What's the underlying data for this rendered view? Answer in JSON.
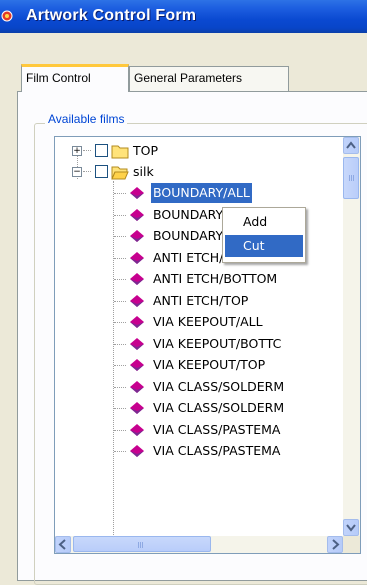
{
  "window": {
    "title": "Artwork Control Form"
  },
  "tabs": [
    {
      "label": "Film Control",
      "active": true
    },
    {
      "label": "General Parameters",
      "active": false
    }
  ],
  "group": {
    "label": "Available films"
  },
  "tree": {
    "folders": [
      {
        "label": "TOP",
        "expanded": false,
        "icon": "folder-closed-icon"
      },
      {
        "label": "silk",
        "expanded": true,
        "icon": "folder-open-icon"
      }
    ],
    "films": [
      {
        "label": "BOUNDARY/ALL",
        "selected": true
      },
      {
        "label": "BOUNDARY/BOTTOM"
      },
      {
        "label": "BOUNDARY/TOP"
      },
      {
        "label": "ANTI ETCH/ALL"
      },
      {
        "label": "ANTI ETCH/BOTTOM"
      },
      {
        "label": "ANTI ETCH/TOP"
      },
      {
        "label": "VIA KEEPOUT/ALL"
      },
      {
        "label": "VIA KEEPOUT/BOTTC"
      },
      {
        "label": "VIA KEEPOUT/TOP"
      },
      {
        "label": "VIA CLASS/SOLDERM"
      },
      {
        "label": "VIA CLASS/SOLDERM"
      },
      {
        "label": "VIA CLASS/PASTEMA"
      },
      {
        "label": "VIA CLASS/PASTEMA"
      }
    ]
  },
  "context_menu": {
    "items": [
      {
        "label": "Add",
        "highlighted": false
      },
      {
        "label": "Cut",
        "highlighted": true
      }
    ]
  },
  "colors": {
    "selection": "#316ac5",
    "film_icon": "#c7008f",
    "title_bar": "#0a49d1"
  }
}
